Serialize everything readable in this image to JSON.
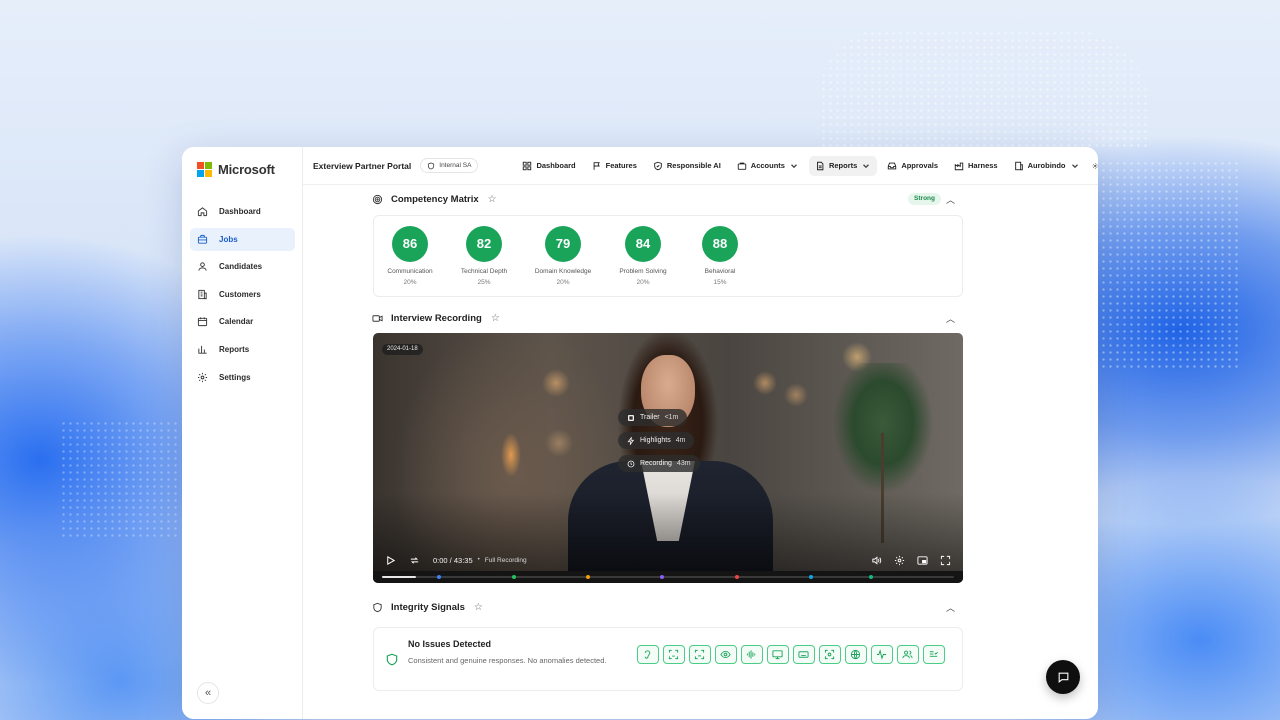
{
  "brand": {
    "name": "Microsoft"
  },
  "sidebar": {
    "items": [
      {
        "label": "Dashboard",
        "icon": "home-icon",
        "active": false
      },
      {
        "label": "Jobs",
        "icon": "briefcase-icon",
        "active": true
      },
      {
        "label": "Candidates",
        "icon": "user-icon",
        "active": false
      },
      {
        "label": "Customers",
        "icon": "building-icon",
        "active": false
      },
      {
        "label": "Calendar",
        "icon": "calendar-icon",
        "active": false
      },
      {
        "label": "Reports",
        "icon": "bar-chart-icon",
        "active": false
      },
      {
        "label": "Settings",
        "icon": "gear-icon",
        "active": false
      }
    ],
    "collapse_glyph": "«"
  },
  "topbar": {
    "portal_title": "Exterview Partner Portal",
    "badge": "Internal SA",
    "menu": [
      {
        "label": "Dashboard",
        "icon": "grid-icon"
      },
      {
        "label": "Features",
        "icon": "flag-icon"
      },
      {
        "label": "Responsible AI",
        "icon": "shield-icon"
      },
      {
        "label": "Accounts",
        "icon": "briefcase-icon",
        "dropdown": true
      },
      {
        "label": "Reports",
        "icon": "document-icon",
        "dropdown": true,
        "active": true
      },
      {
        "label": "Approvals",
        "icon": "inbox-icon"
      },
      {
        "label": "Harness",
        "icon": "factory-icon"
      },
      {
        "label": "Aurobindo",
        "icon": "building-icon",
        "dropdown": true
      }
    ]
  },
  "competency": {
    "title": "Competency Matrix",
    "badge": "Strong",
    "scores": [
      {
        "value": "86",
        "label": "Communication",
        "weight": "20%"
      },
      {
        "value": "82",
        "label": "Technical Depth",
        "weight": "25%"
      },
      {
        "value": "79",
        "label": "Domain Knowledge",
        "weight": "20%"
      },
      {
        "value": "84",
        "label": "Problem Solving",
        "weight": "20%"
      },
      {
        "value": "88",
        "label": "Behavioral",
        "weight": "15%"
      }
    ]
  },
  "recording": {
    "title": "Interview Recording",
    "date": "2024-01-18",
    "options": [
      {
        "label": "Trailer",
        "duration": "<1m",
        "icon": "film-icon"
      },
      {
        "label": "Highlights",
        "duration": "4m",
        "icon": "lightning-icon"
      },
      {
        "label": "Recording",
        "duration": "43m",
        "icon": "clock-icon"
      }
    ],
    "time": "0:00 / 43:35",
    "mode": "Full Recording",
    "progress": 0.06,
    "marker_colors": [
      "#3b82f6",
      "#22c55e",
      "#f59e0b",
      "#8b5cf6",
      "#ef4444",
      "#0ea5e9",
      "#10b981"
    ]
  },
  "integrity": {
    "title": "Integrity Signals",
    "status_title": "No Issues Detected",
    "status_desc": "Consistent and genuine responses. No anomalies detected.",
    "signal_icons": [
      "ear-icon",
      "face-scan-icon",
      "face-scan-alt-icon",
      "eye-icon",
      "audio-wave-icon",
      "monitor-icon",
      "keyboard-icon",
      "focus-icon",
      "globe-icon",
      "pulse-icon",
      "users-icon",
      "text-check-icon"
    ]
  },
  "colors": {
    "accent": "#1a5fc8",
    "score_green": "#1aa45a",
    "signal_green": "#1aa45a"
  }
}
